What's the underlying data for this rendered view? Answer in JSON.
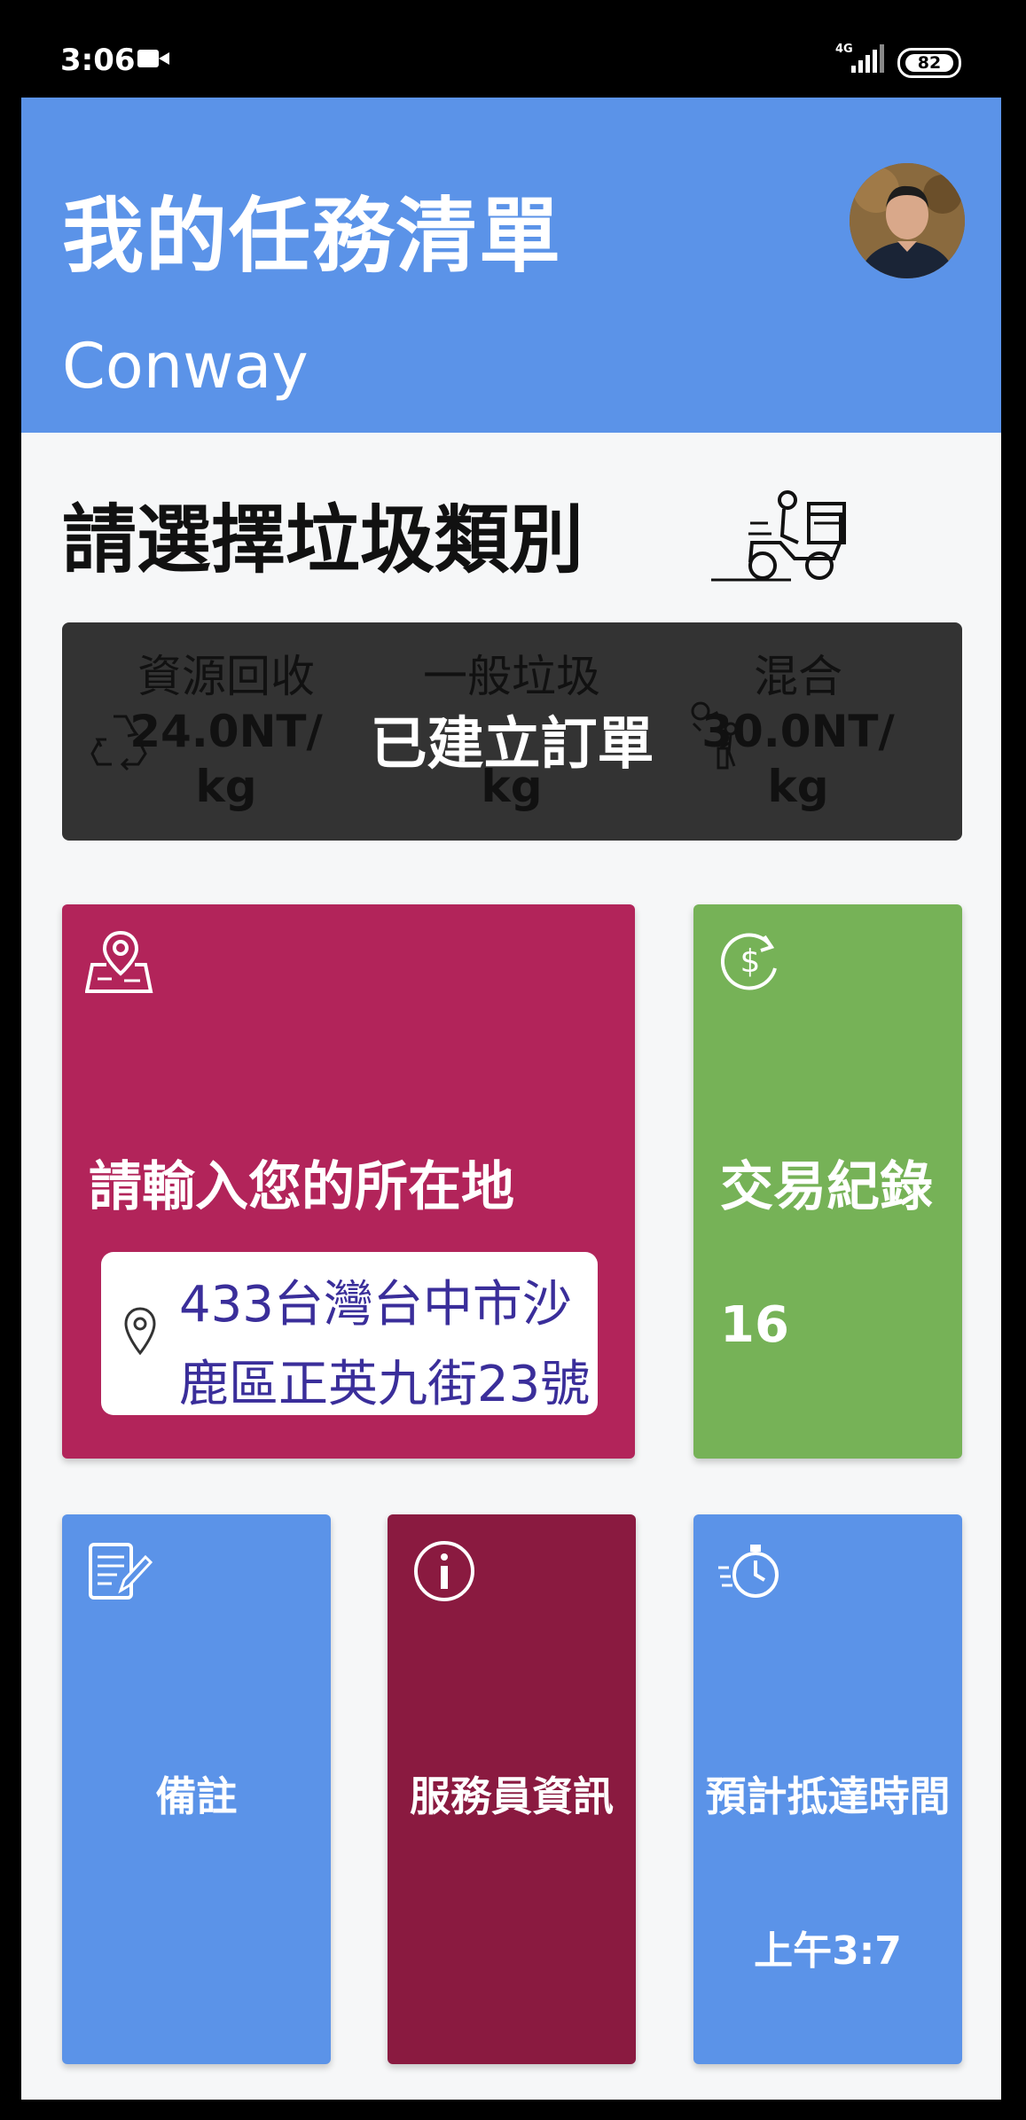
{
  "status_bar": {
    "time": "3:06",
    "network": "4G",
    "battery": "82"
  },
  "header": {
    "title": "我的任務清單",
    "username": "Conway"
  },
  "category_section": {
    "prompt": "請選擇垃圾類別",
    "categories": [
      {
        "name": "資源回收",
        "price": "24.0NT/",
        "unit": "kg",
        "icon": "recycle-icon"
      },
      {
        "name": "一般垃圾",
        "price": "",
        "unit": "kg",
        "icon": "trash-icon"
      },
      {
        "name": "混合",
        "price": "30.0NT/",
        "unit": "kg",
        "icon": "mixed-waste-icon"
      }
    ],
    "toast": "已建立訂單"
  },
  "location_card": {
    "label": "請輸入您的所在地",
    "address_line1": "433台灣台中市沙",
    "address_line2": "鹿區正英九街23號"
  },
  "transaction_card": {
    "label": "交易紀錄",
    "count": "16"
  },
  "bottom_cards": {
    "note_label": "備註",
    "staff_label": "服務員資訊",
    "eta_label": "預計抵達時間",
    "eta_time": "上午3:7"
  },
  "colors": {
    "primary_blue": "#5b93e8",
    "location_magenta": "#b2245a",
    "transaction_green": "#76b257",
    "staff_maroon": "#8a1a40",
    "toast_bg": "#333333"
  }
}
